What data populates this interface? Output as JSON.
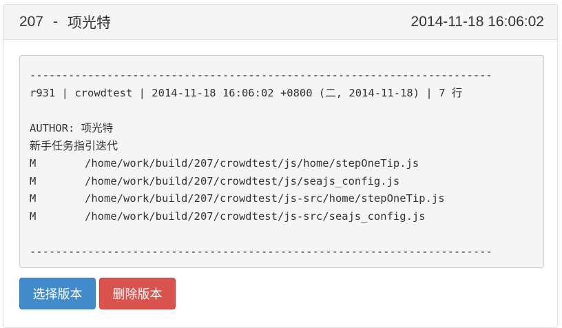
{
  "header": {
    "revision_id": "207",
    "separator": "-",
    "author": "项光特",
    "datetime": "2014-11-18 16:06:02"
  },
  "log": {
    "divider_top": "------------------------------------------------------------------------",
    "commit_line": "r931 | crowdtest | 2014-11-18 16:06:02 +0800 (二, 2014-11-18) | 7 行",
    "author_line": "AUTHOR: 项光特",
    "message": "新手任务指引迭代",
    "files": [
      {
        "status": "M",
        "path": "/home/work/build/207/crowdtest/js/home/stepOneTip.js"
      },
      {
        "status": "M",
        "path": "/home/work/build/207/crowdtest/js/seajs_config.js"
      },
      {
        "status": "M",
        "path": "/home/work/build/207/crowdtest/js-src/home/stepOneTip.js"
      },
      {
        "status": "M",
        "path": "/home/work/build/207/crowdtest/js-src/seajs_config.js"
      }
    ],
    "divider_bottom": "------------------------------------------------------------------------"
  },
  "actions": {
    "select_label": "选择版本",
    "delete_label": "删除版本"
  },
  "colors": {
    "primary": "#428bca",
    "danger": "#d9534f",
    "heading_bg": "#f5f5f5",
    "log_bg": "#f5f5f5"
  }
}
